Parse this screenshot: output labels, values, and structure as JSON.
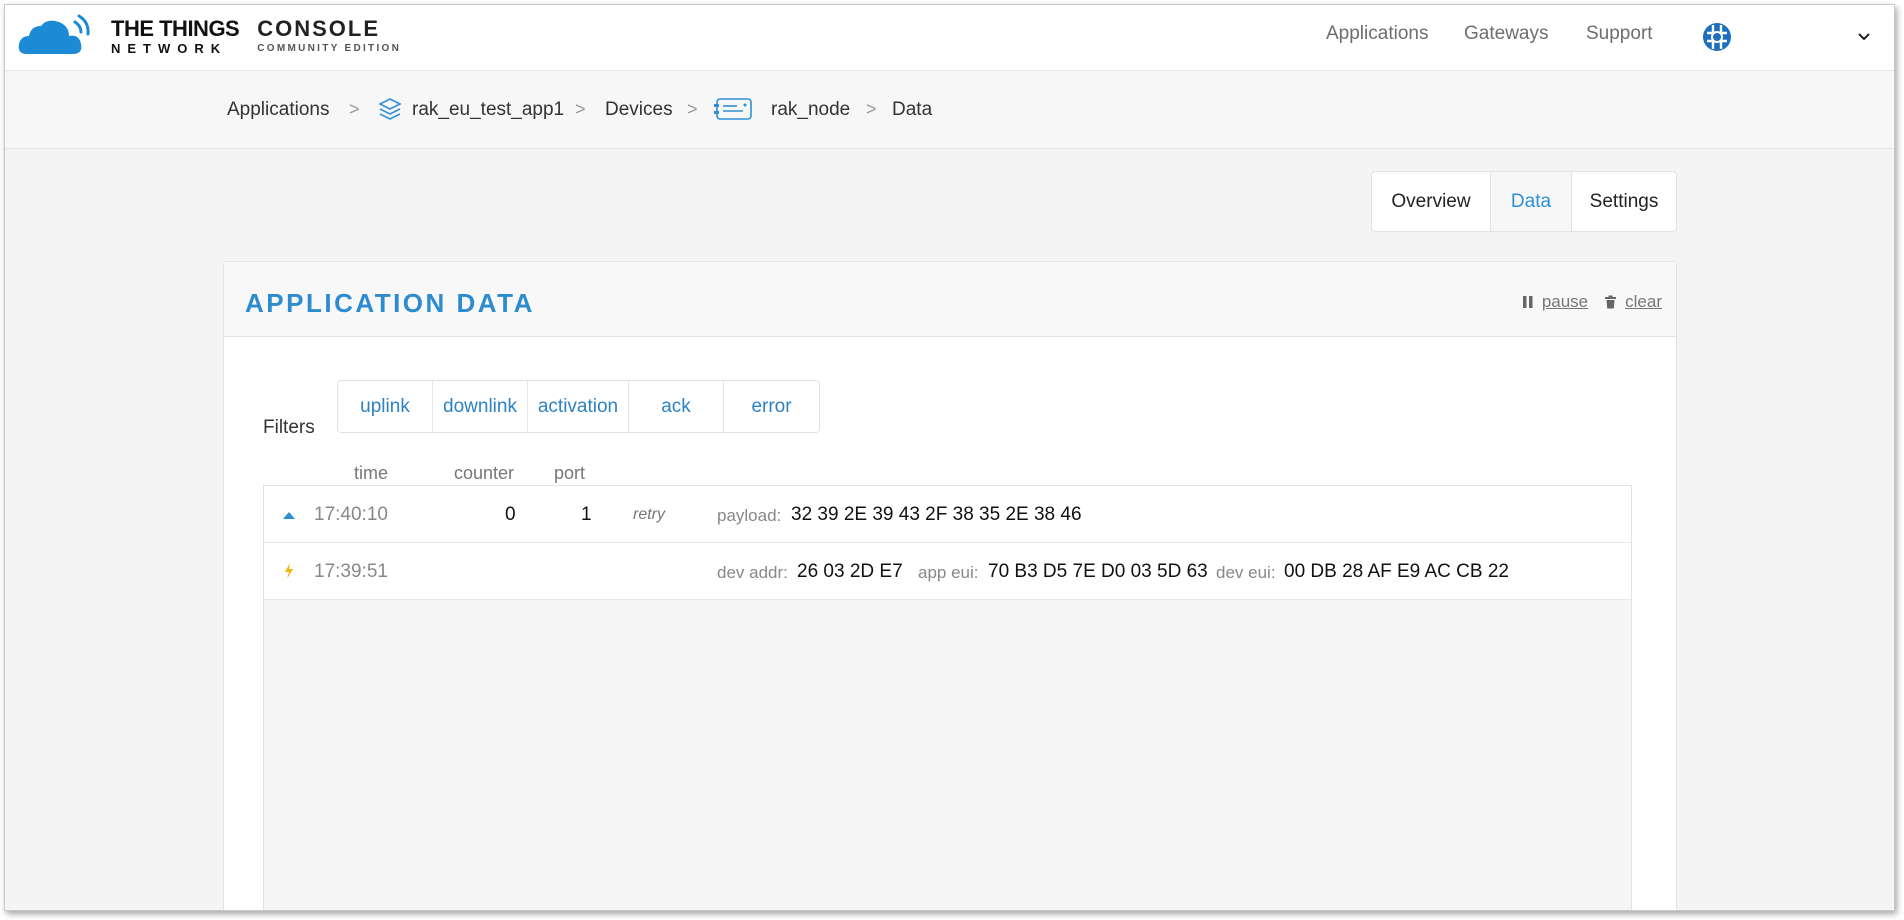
{
  "header": {
    "brand_line1": "THE THINGS",
    "brand_line2": "NETWORK",
    "console_line1": "CONSOLE",
    "console_line2": "COMMUNITY EDITION",
    "nav": [
      "Applications",
      "Gateways",
      "Support"
    ]
  },
  "breadcrumb": {
    "items": [
      "Applications",
      "rak_eu_test_app1",
      "Devices",
      "rak_node",
      "Data"
    ],
    "separator": ">"
  },
  "tabs": [
    "Overview",
    "Data",
    "Settings"
  ],
  "active_tab": "Data",
  "panel": {
    "title": "APPLICATION DATA",
    "pause_label": "pause",
    "clear_label": "clear"
  },
  "filters": {
    "label": "Filters",
    "items": [
      "uplink",
      "downlink",
      "activation",
      "ack",
      "error"
    ]
  },
  "columns": {
    "time": "time",
    "counter": "counter",
    "port": "port"
  },
  "rows": [
    {
      "type_icon": "uplink-arrow-icon",
      "time": "17:40:10",
      "counter": "0",
      "port": "1",
      "flag": "retry",
      "payload_label": "payload:",
      "payload": "32 39 2E 39 43 2F 38 35 2E 38 46"
    },
    {
      "type_icon": "activation-bolt-icon",
      "time": "17:39:51",
      "dev_addr_label": "dev addr:",
      "dev_addr": "26 03 2D E7",
      "app_eui_label": "app eui:",
      "app_eui": "70 B3 D5 7E D0 03 5D 63",
      "dev_eui_label": "dev eui:",
      "dev_eui": "00 DB 28 AF E9 AC CB 22"
    }
  ],
  "colors": {
    "accent": "#2e8fd6",
    "bolt": "#f5b400"
  }
}
